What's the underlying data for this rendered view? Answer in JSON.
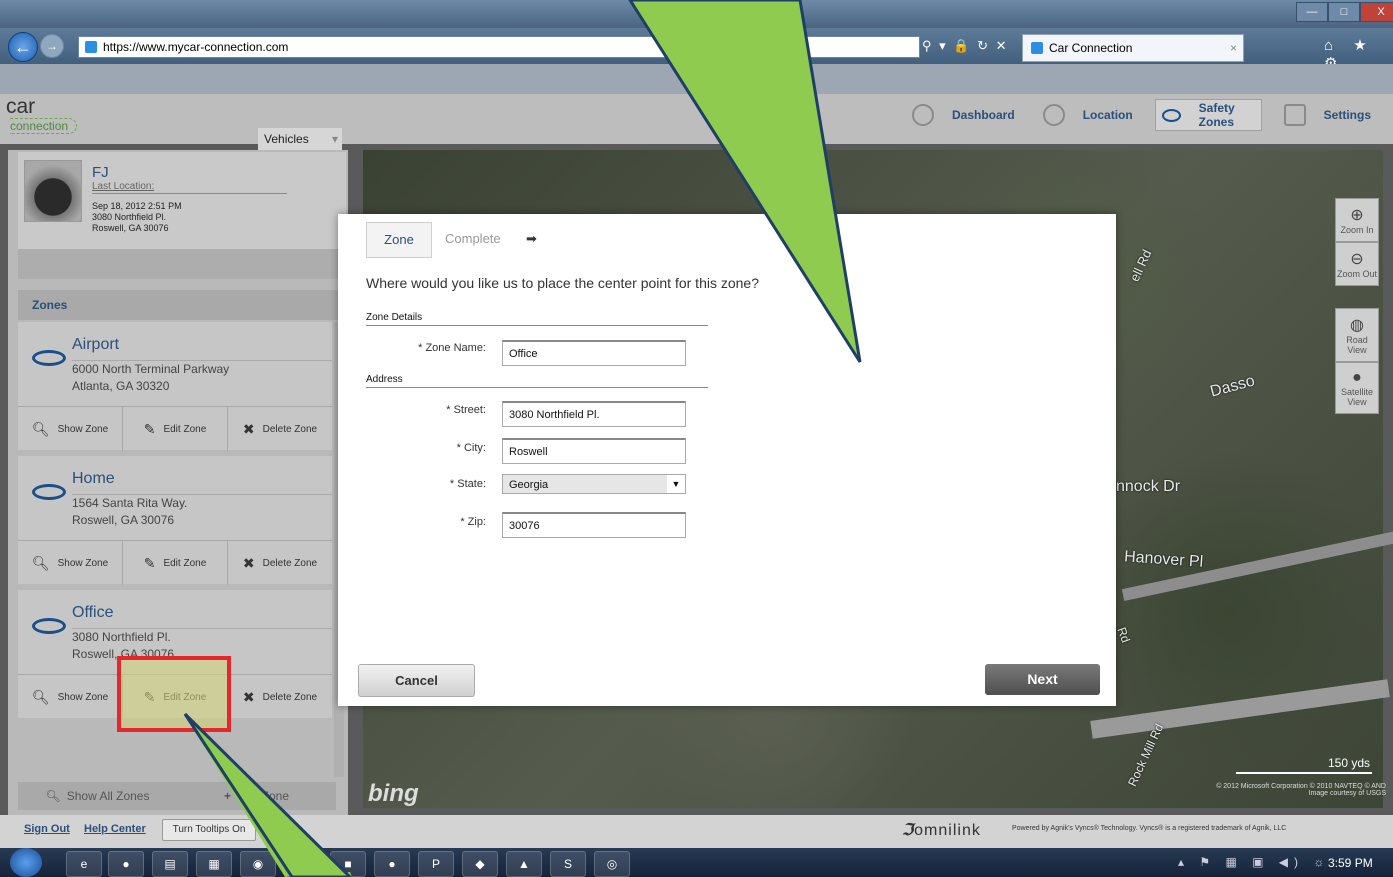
{
  "browser": {
    "url": "https://www.mycar-connection.com",
    "tab_title": "Car Connection",
    "tab_close": "×",
    "address_controls": "⚲ ▾ 🔒 ↻ ✕",
    "tool_icons": "⌂ ★ ⚙",
    "win_min": "—",
    "win_max": "□",
    "win_close": "X"
  },
  "app": {
    "logo_top": "car",
    "logo_bottom": "connection",
    "nav": [
      {
        "label": "Dashboard",
        "icon": "steering-wheel-icon"
      },
      {
        "label": "Location",
        "icon": "location-icon"
      },
      {
        "label": "Safety Zones",
        "icon": "zone-oval-icon",
        "selected": true
      },
      {
        "label": "Settings",
        "icon": "settings-pin-icon"
      }
    ],
    "vehicles_tab": "Vehicles",
    "vehicles_dropdown": "▾"
  },
  "vehicle": {
    "name": "FJ",
    "last_location_label": "Last Location:",
    "timestamp": "Sep 18, 2012 2:51 PM",
    "address1": "3080 Northfield Pl.",
    "address2": "Roswell, GA 30076"
  },
  "zones": {
    "header": "Zones",
    "items": [
      {
        "name": "Airport",
        "line1": "6000 North Terminal Parkway",
        "line2": "Atlanta, GA 30320"
      },
      {
        "name": "Home",
        "line1": "1564 Santa Rita Way.",
        "line2": "Roswell, GA 30076"
      },
      {
        "name": "Office",
        "line1": "3080 Northfield Pl.",
        "line2": "Roswell, GA 30076"
      }
    ],
    "show_label": "Show Zone",
    "edit_label": "Edit Zone",
    "delete_label": "Delete Zone",
    "show_all": "Show All Zones",
    "add_zone": "Add Zone"
  },
  "map": {
    "labels": [
      "Dasso",
      "nnock Dr",
      "Hanover Pl",
      "Rd",
      "Rock Mill Rd",
      "ell Rd"
    ],
    "zoom_in": "Zoom In",
    "zoom_out": "Zoom Out",
    "road_view": "Road View",
    "satellite_view": "Satellite View",
    "scale": "150 yds",
    "bing": "bing",
    "copyright": "© 2012 Microsoft Corporation   © 2010 NAVTEQ   © AND",
    "image_courtesy": "Image courtesy of USGS"
  },
  "footer": {
    "sign_out": "Sign Out",
    "help_center": "Help Center",
    "tooltips": "Turn Tooltips On",
    "omnilink": "omnilink",
    "powered": "Powered by Agnik's Vyncs® Technology. Vyncs® is a registered trademark of Agnik, LLC"
  },
  "taskbar": {
    "clock": "3:59 PM",
    "tray": "▴ ⚑ ▦ ▣ ◀) ☼"
  },
  "modal": {
    "tab_zone": "Zone",
    "tab_complete": "Complete",
    "tab_arrow": "➡",
    "question": "Where would you like us to place the center point for this zone?",
    "section_details": "Zone Details",
    "section_address": "Address",
    "zone_name_label": "* Zone Name:",
    "zone_name_value": "Office",
    "street_label": "* Street:",
    "street_value": "3080 Northfield Pl.",
    "city_label": "* City:",
    "city_value": "Roswell",
    "state_label": "* State:",
    "state_value": "Georgia",
    "zip_label": "* Zip:",
    "zip_value": "30076",
    "cancel": "Cancel",
    "next": "Next"
  }
}
